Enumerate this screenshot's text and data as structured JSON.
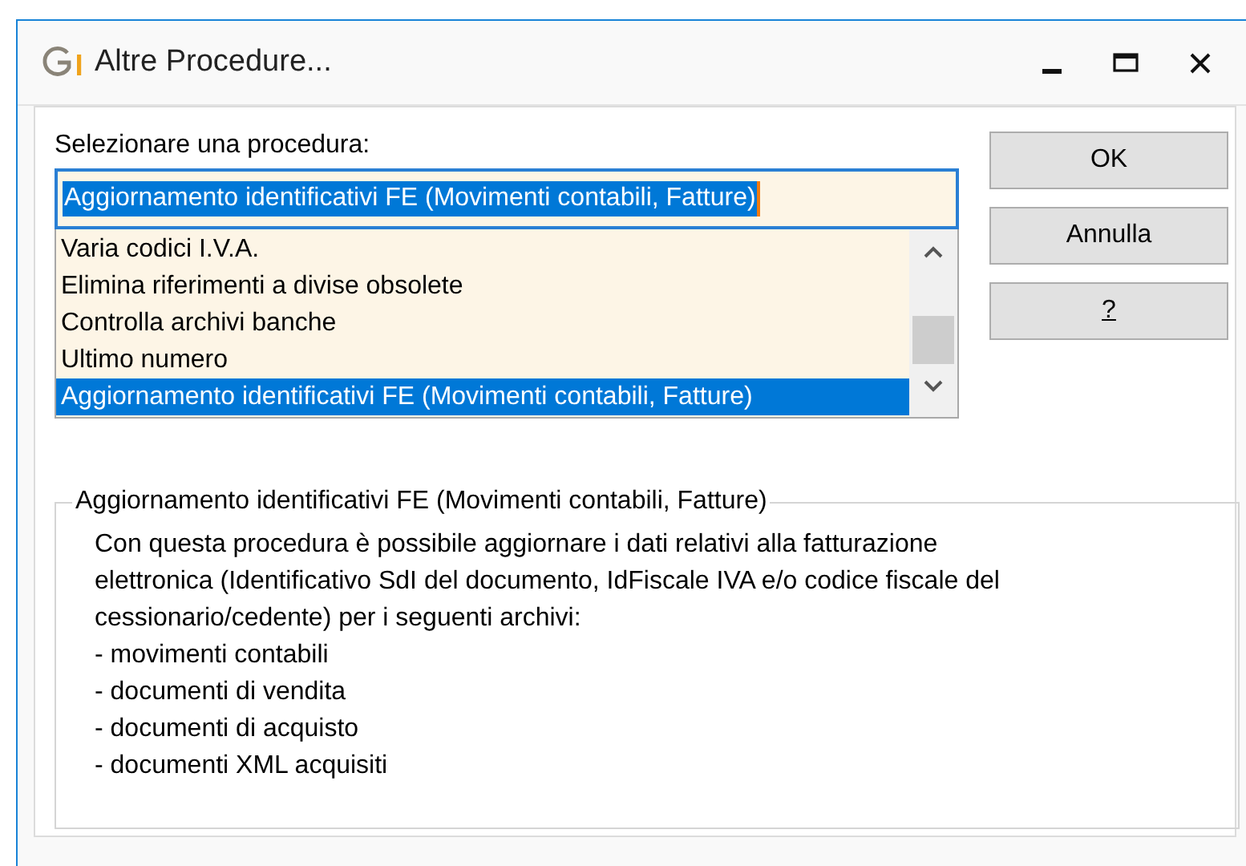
{
  "window": {
    "title": "Altre Procedure..."
  },
  "prompt": "Selezionare una procedura:",
  "combo": {
    "value": "Aggiornamento identificativi FE (Movimenti contabili, Fatture)"
  },
  "list": {
    "items": [
      {
        "label": "Varia codici I.V.A.",
        "selected": false
      },
      {
        "label": "Elimina riferimenti a divise obsolete",
        "selected": false
      },
      {
        "label": "Controlla archivi banche",
        "selected": false
      },
      {
        "label": "Ultimo numero",
        "selected": false
      },
      {
        "label": "Aggiornamento identificativi FE (Movimenti contabili, Fatture)",
        "selected": true
      }
    ]
  },
  "buttons": [
    {
      "label": "OK",
      "underlined": false
    },
    {
      "label": "Annulla",
      "underlined": false
    },
    {
      "label": "?",
      "underlined": true
    }
  ],
  "description": {
    "title": "Aggiornamento identificativi FE (Movimenti contabili, Fatture)",
    "paragraph": "Con questa procedura è possibile aggiornare i dati relativi alla fatturazione elettronica (Identificativo SdI del documento, IdFiscale IVA e/o codice fiscale del cessionario/cedente) per i seguenti archivi:",
    "list_items": [
      "- movimenti contabili",
      "- documenti di vendita",
      "- documenti di acquisto",
      "- documenti XML acquisiti"
    ]
  }
}
